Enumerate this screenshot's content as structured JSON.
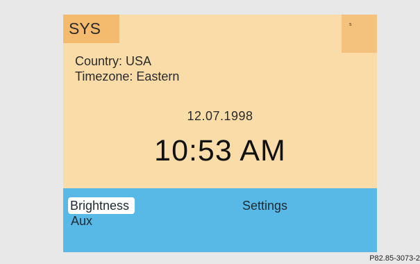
{
  "screen": {
    "tab_label": "SYS",
    "corner_label": "s",
    "country_line": "Country: USA",
    "timezone_line": "Timezone: Eastern",
    "date": "12.07.1998",
    "time": "10:53 AM"
  },
  "menu": {
    "items": [
      {
        "label": "Brightness",
        "selected": true
      },
      {
        "label": "Settings",
        "selected": false
      },
      {
        "label": "Aux",
        "selected": false
      }
    ]
  },
  "figure_ref": "P82.85-3073-2",
  "colors": {
    "screen_bg": "#f9dca8",
    "tab_bg": "#f4ba6e",
    "menu_bg": "#58b9e7",
    "selection_bg": "#ffffff"
  }
}
